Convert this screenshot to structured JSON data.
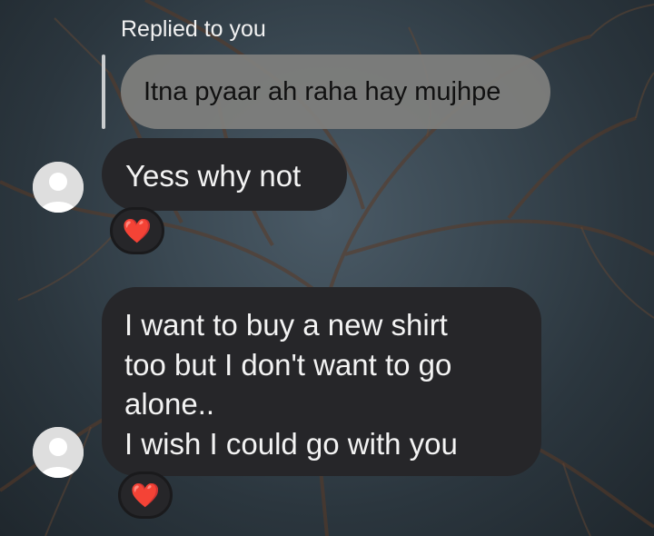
{
  "reply_header": {
    "label": "Replied to you"
  },
  "quoted_message": {
    "text": "Itna pyaar ah raha hay mujhpe"
  },
  "messages": [
    {
      "lines": [
        "Yess why not"
      ],
      "reaction": "❤️"
    },
    {
      "lines": [
        "I want to buy a new shirt",
        "too but I don't want to go",
        "alone..",
        "I wish I could go with you"
      ],
      "reaction": "❤️"
    }
  ],
  "icons": {
    "avatar": "default-user-avatar-icon",
    "reaction": "heart-icon"
  },
  "colors": {
    "incoming_bubble": "#262629",
    "quoted_bubble": "#80807e",
    "reaction_heart": "#e0303a"
  }
}
